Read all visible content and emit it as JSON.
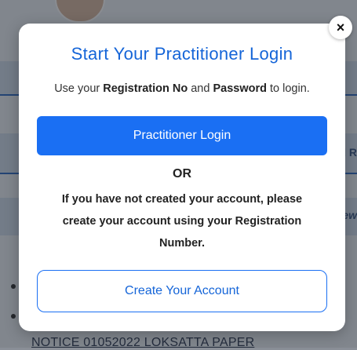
{
  "background": {
    "notice_text": "NOTICE 01052022 LOKSATTA PAPER",
    "edge_text_1": "d R",
    "edge_text_2": "ew"
  },
  "modal": {
    "title": "Start Your Practitioner Login",
    "subtitle_prefix": "Use your ",
    "subtitle_reg": "Registration No",
    "subtitle_mid": " and ",
    "subtitle_pwd": "Password",
    "subtitle_suffix": " to login.",
    "login_button": "Practitioner Login",
    "or_label": "OR",
    "info_text": "If you have not created your account, please create your account using your Registration Number.",
    "create_button": "Create Your Account",
    "close_glyph": "×"
  },
  "colors": {
    "primary": "#1a6ff3",
    "title": "#1565d8"
  },
  "icons": {
    "close": "close-icon"
  }
}
